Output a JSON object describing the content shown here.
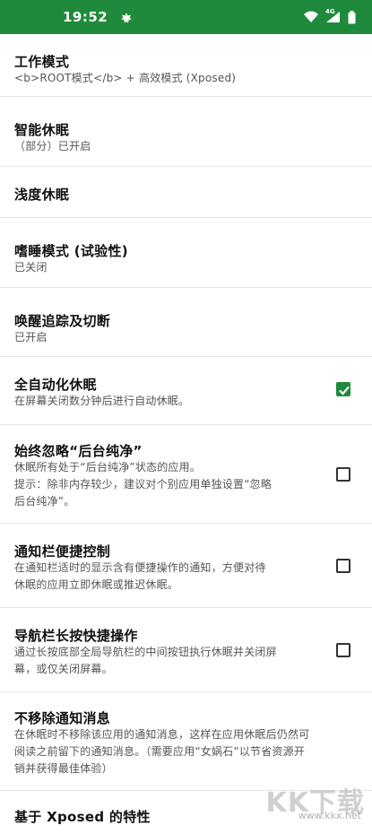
{
  "status_bar": {
    "time": "19:52",
    "network_label": "4G",
    "background_color": "#1f8a3b"
  },
  "settings": [
    {
      "title": "工作模式",
      "summary": "<b>ROOT模式</b> + 高效模式 (Xposed)",
      "checkbox": null
    },
    {
      "title": "智能休眠",
      "summary": "（部分）已开启",
      "checkbox": null
    },
    {
      "title": "浅度休眠",
      "summary": "",
      "checkbox": null
    },
    {
      "title": "嗜睡模式 (试验性)",
      "summary": "已关闭",
      "checkbox": null
    },
    {
      "title": "唤醒追踪及切断",
      "summary": "已开启",
      "checkbox": null
    },
    {
      "title": "全自动化休眠",
      "summary": "在屏幕关闭数分钟后进行自动休眠。",
      "checkbox": true
    },
    {
      "title": "始终忽略“后台纯净”",
      "summary_lines": [
        "休眠所有处于“后台纯净”状态的应用。",
        "提示：除非内存较少，建议对个别应用单独设置“忽略",
        "后台纯净”。"
      ],
      "checkbox": false
    },
    {
      "title": "通知栏便捷控制",
      "summary_lines": [
        "在通知栏适时的显示含有便捷操作的通知，方便对待",
        "休眠的应用立即休眠或推迟休眠。"
      ],
      "checkbox": false
    },
    {
      "title": "导航栏长按快捷操作",
      "summary_lines": [
        "通过长按底部全局导航栏的中间按钮执行休眠并关闭屏",
        "幕，或仅关闭屏幕。"
      ],
      "checkbox": false
    },
    {
      "title": "不移除通知消息",
      "summary_lines": [
        "在休眠时不移除该应用的通知消息，这样在应用休眠后仍然可",
        "阅读之前留下的通知消息。（需要应用“女娲石”以节省资源开",
        "销并获得最佳体验）"
      ],
      "checkbox": null
    },
    {
      "title": "基于 Xposed 的特性",
      "summary": "",
      "checkbox": null
    }
  ],
  "watermark": {
    "text": "KK下载",
    "url": "www.kkx.net"
  },
  "colors": {
    "accent": "#1f8a3b",
    "divider": "#e4e4e4"
  }
}
